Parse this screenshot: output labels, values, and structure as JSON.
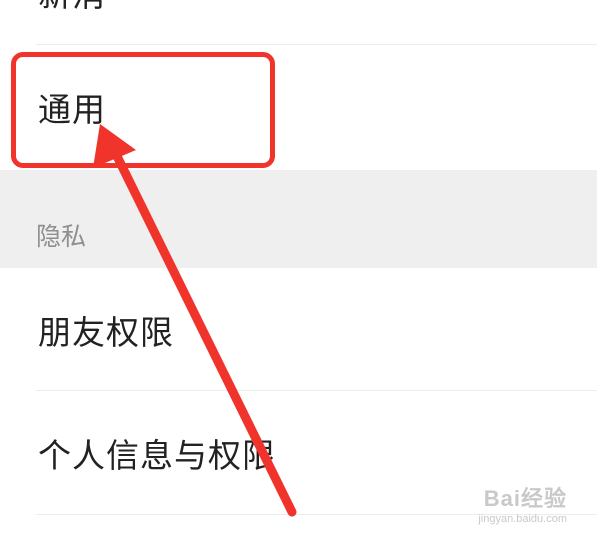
{
  "settings": {
    "items": [
      {
        "label": "新消"
      },
      {
        "label": "通用"
      },
      {
        "label": "朋友权限"
      },
      {
        "label": "个人信息与权限"
      }
    ],
    "sections": [
      {
        "label": "隐私"
      }
    ]
  },
  "watermark": {
    "brand": "Bai经验",
    "url": "jingyan.baidu.com"
  },
  "colors": {
    "annotation": "#f0342c",
    "section_bg": "#efefef",
    "text": "#222222",
    "section_text": "#8f8f8f"
  }
}
